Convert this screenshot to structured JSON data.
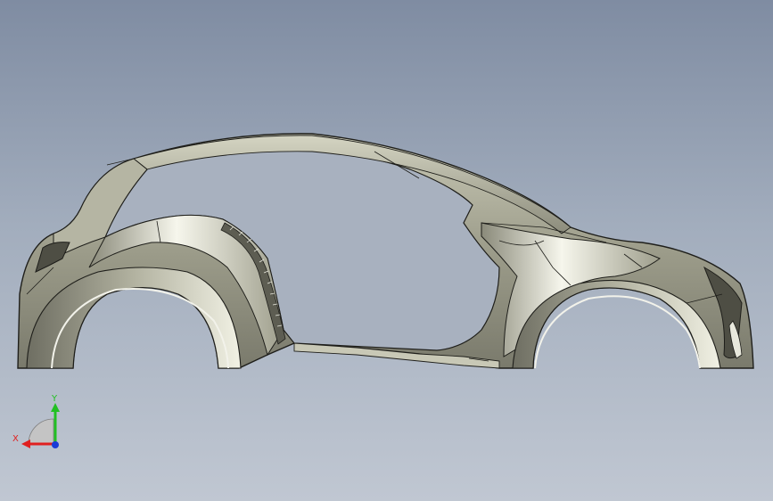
{
  "viewport": {
    "background_top": "#7f8ca2",
    "background_bottom": "#c0c7d2",
    "model": {
      "body_color": "#a8a896",
      "edge_color": "#1e1e1a"
    }
  },
  "triad": {
    "x_label": "X",
    "y_label": "Y",
    "x_color": "#e02020",
    "y_color": "#22c022",
    "z_color": "#1a3bd6"
  }
}
